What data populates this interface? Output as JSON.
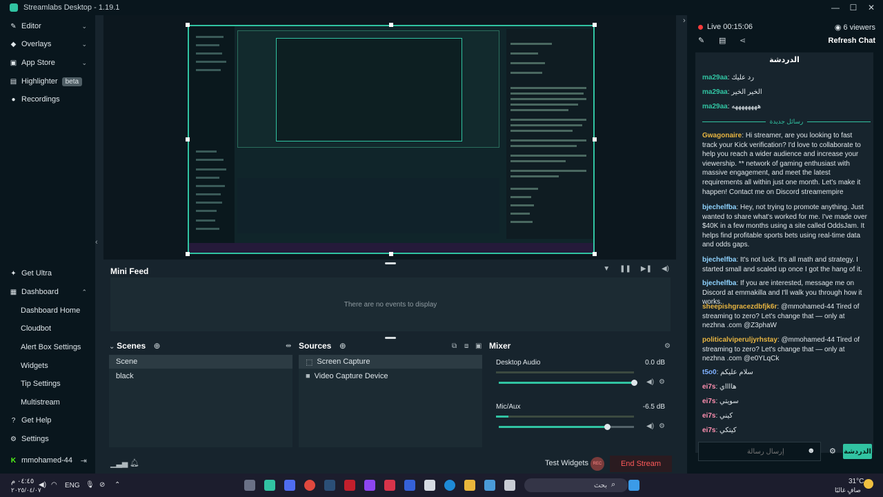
{
  "window": {
    "title": "Streamlabs Desktop - 1.19.1"
  },
  "sidebar": {
    "top_items": [
      {
        "label": "Editor",
        "icon": "pencil-icon"
      },
      {
        "label": "Overlays",
        "icon": "layers-icon"
      },
      {
        "label": "App Store",
        "icon": "store-icon"
      },
      {
        "label": "Highlighter",
        "icon": "highlighter-icon",
        "badge": "beta"
      },
      {
        "label": "Recordings",
        "icon": "record-icon"
      }
    ],
    "get_ultra": "Get Ultra",
    "dashboard": "Dashboard",
    "dashboard_items": [
      "Dashboard Home",
      "Cloudbot",
      "Alert Box Settings",
      "Widgets",
      "Tip Settings",
      "Multistream"
    ],
    "get_help": "Get Help",
    "settings": "Settings",
    "user": "mmohamed-44"
  },
  "minifeed": {
    "title": "Mini Feed",
    "empty": "There are no events to display"
  },
  "scenes": {
    "title": "Scenes",
    "items": [
      "Scene",
      "black"
    ]
  },
  "sources": {
    "title": "Sources",
    "items": [
      "Screen Capture",
      "Video Capture Device"
    ]
  },
  "mixer": {
    "title": "Mixer",
    "channels": [
      {
        "name": "Desktop Audio",
        "db": "0.0 dB",
        "level": 0.0,
        "volume": 1.0
      },
      {
        "name": "Mic/Aux",
        "db": "-6.5 dB",
        "level": 0.09,
        "volume": 0.8
      }
    ]
  },
  "footer": {
    "test_widgets": "Test Widgets",
    "rec": "REC",
    "end_stream": "End Stream"
  },
  "live": {
    "status": "Live 00:15:06",
    "viewers": "6 viewers",
    "refresh": "Refresh Chat"
  },
  "chat": {
    "header": "الدردشة",
    "separator": "رسائل جديدة",
    "messages": [
      {
        "user": "ma29aa",
        "text": "رد عليك",
        "color": "#31c3a2"
      },
      {
        "user": "ma29aa",
        "text": "الخير الخير",
        "color": "#31c3a2"
      },
      {
        "user": "ma29aa",
        "text": "ههههههههه",
        "color": "#31c3a2"
      },
      {
        "user": "Gwagonaire",
        "text": "Hi streamer, are you looking to fast track your Kick verification? I'd love to collaborate to help you reach a wider audience and increase your viewership. ** network of gaming enthusiast with massive engagement, and meet the latest requirements all within just one month. Let's make it happen! Contact me on Discord streamempire",
        "color": "#e8b541"
      },
      {
        "user": "bjechelfba",
        "text": "Hey, not trying to promote anything. Just wanted to share what's worked for me. I've made over $40K in a few months using a site called OddsJam. It helps find profitable sports bets using real-time data and odds gaps.",
        "color": "#8fd3ff"
      },
      {
        "user": "bjechelfba",
        "text": "It's not luck. It's all math and strategy. I started small and scaled up once I got the hang of it.",
        "color": "#8fd3ff"
      },
      {
        "user": "bjechelfba",
        "text": "If you are interested, message me on Discord at emmakilla and I'll walk you through how it works.",
        "color": "#8fd3ff"
      },
      {
        "user": "sheepishgracezdbfjk6r",
        "text": "@mmohamed-44 Tired of streaming to zero? Let's change that — only at nezhna .com @Z3phaW",
        "color": "#e8b541"
      },
      {
        "user": "politicalviperuljyrhstay",
        "text": "@mmohamed-44 Tired of streaming to zero? Let's change that — only at nezhna .com @e0YLqCk",
        "color": "#e8b541"
      },
      {
        "user": "t5o0",
        "text": "سلام عليكم",
        "color": "#7fb0ff"
      },
      {
        "user": "ei7s",
        "text": "هااااي",
        "color": "#ff8fb0"
      },
      {
        "user": "ei7s",
        "text": "سويتي",
        "color": "#ff8fb0"
      },
      {
        "user": "ei7s",
        "text": "كيني",
        "color": "#ff8fb0"
      },
      {
        "user": "ei7s",
        "text": "كيتكي",
        "color": "#ff8fb0"
      }
    ],
    "input_placeholder": "إرسال رسالة",
    "send": "الدردشة"
  },
  "taskbar": {
    "time": "٠٤:٤٥ م",
    "date": "٢٠٢٥/٠٤/٠٧",
    "lang": "ENG",
    "search": "بحث",
    "weather_temp": "31°C",
    "weather_desc": "صافٍ غالبًا"
  }
}
